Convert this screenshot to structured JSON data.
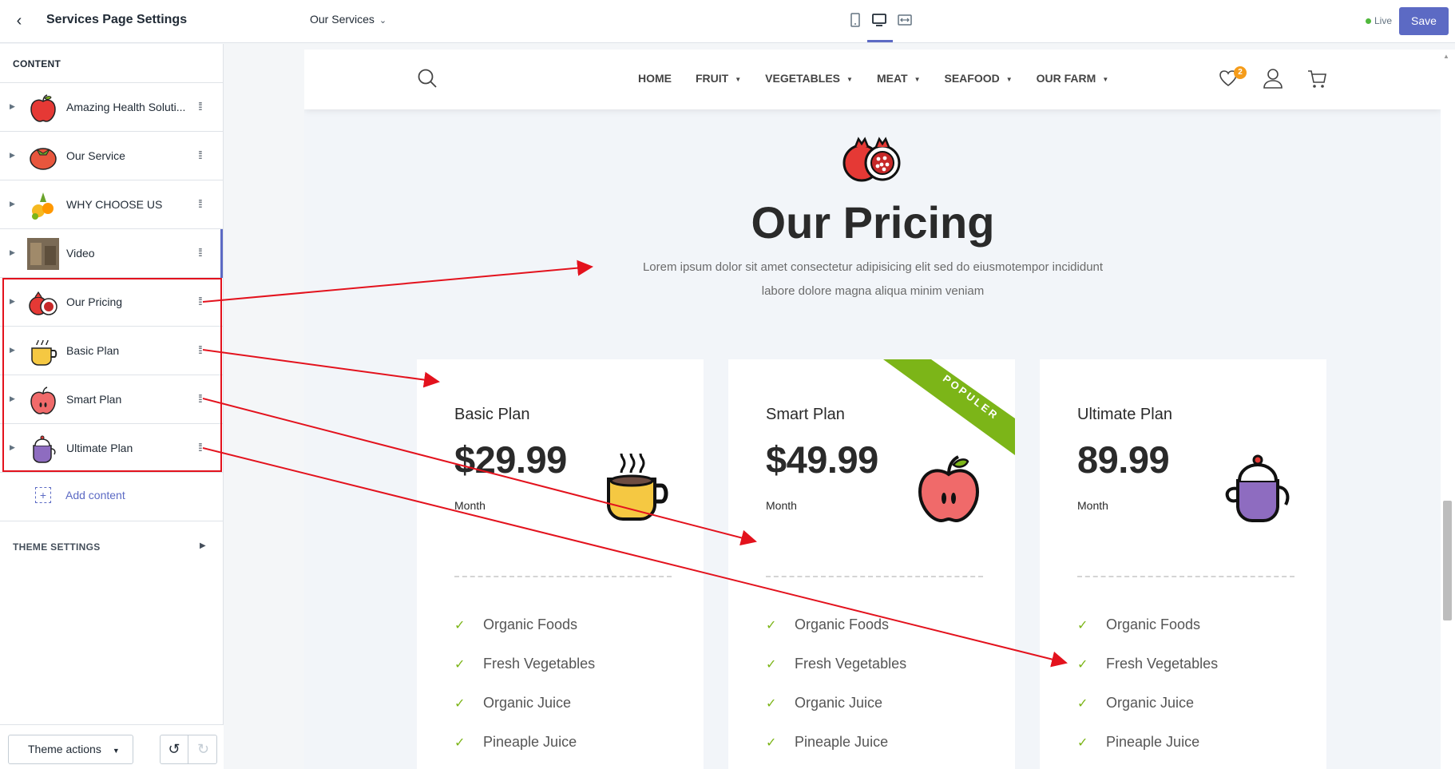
{
  "topbar": {
    "sidebar_title": "Services Page Settings",
    "page_select": "Our Services",
    "devices": [
      "mobile-icon",
      "desktop-icon",
      "fullwidth-icon"
    ],
    "live_label": "Live",
    "save_label": "Save"
  },
  "sidebar": {
    "content_heading": "CONTENT",
    "items": [
      {
        "label": "Amazing Health Soluti...",
        "icon": "apple-thumb"
      },
      {
        "label": "Our Service",
        "icon": "tomato-thumb"
      },
      {
        "label": "WHY CHOOSE US",
        "icon": "fruit-thumb"
      },
      {
        "label": "Video",
        "icon": "video-thumb"
      },
      {
        "label": "Our Pricing",
        "icon": "pomegranate-thumb"
      },
      {
        "label": "Basic Plan",
        "icon": "mug-thumb"
      },
      {
        "label": "Smart Plan",
        "icon": "apple-thumb"
      },
      {
        "label": "Ultimate Plan",
        "icon": "teapot-thumb"
      }
    ],
    "add_content": "Add content",
    "theme_settings": "THEME SETTINGS",
    "theme_actions": "Theme actions"
  },
  "preview": {
    "nav": [
      "HOME",
      "FRUIT",
      "VEGETABLES",
      "MEAT",
      "SEAFOOD",
      "OUR FARM"
    ],
    "wishlist_count": "2",
    "section_title": "Our Pricing",
    "section_desc": "Lorem ipsum dolor sit amet consectetur adipisicing elit sed do eiusmotempor incididunt labore dolore magna aliqua minim veniam",
    "ribbon": "POPULER",
    "plans": [
      {
        "name": "Basic Plan",
        "price": "$29.99",
        "period": "Month",
        "icon": "mug-icon",
        "features": [
          "Organic Foods",
          "Fresh Vegetables",
          "Organic Juice",
          "Pineaple Juice"
        ]
      },
      {
        "name": "Smart Plan",
        "price": "$49.99",
        "period": "Month",
        "icon": "apple-icon",
        "features": [
          "Organic Foods",
          "Fresh Vegetables",
          "Organic Juice",
          "Pineaple Juice"
        ]
      },
      {
        "name": "Ultimate Plan",
        "price": "89.99",
        "period": "Month",
        "icon": "teapot-icon",
        "features": [
          "Organic Foods",
          "Fresh Vegetables",
          "Organic Juice",
          "Pineaple Juice"
        ]
      }
    ]
  },
  "colors": {
    "accent": "#5c6ac4",
    "annotation": "#e3121d",
    "ribbon": "#7cb518",
    "badge": "#f59c1a"
  }
}
